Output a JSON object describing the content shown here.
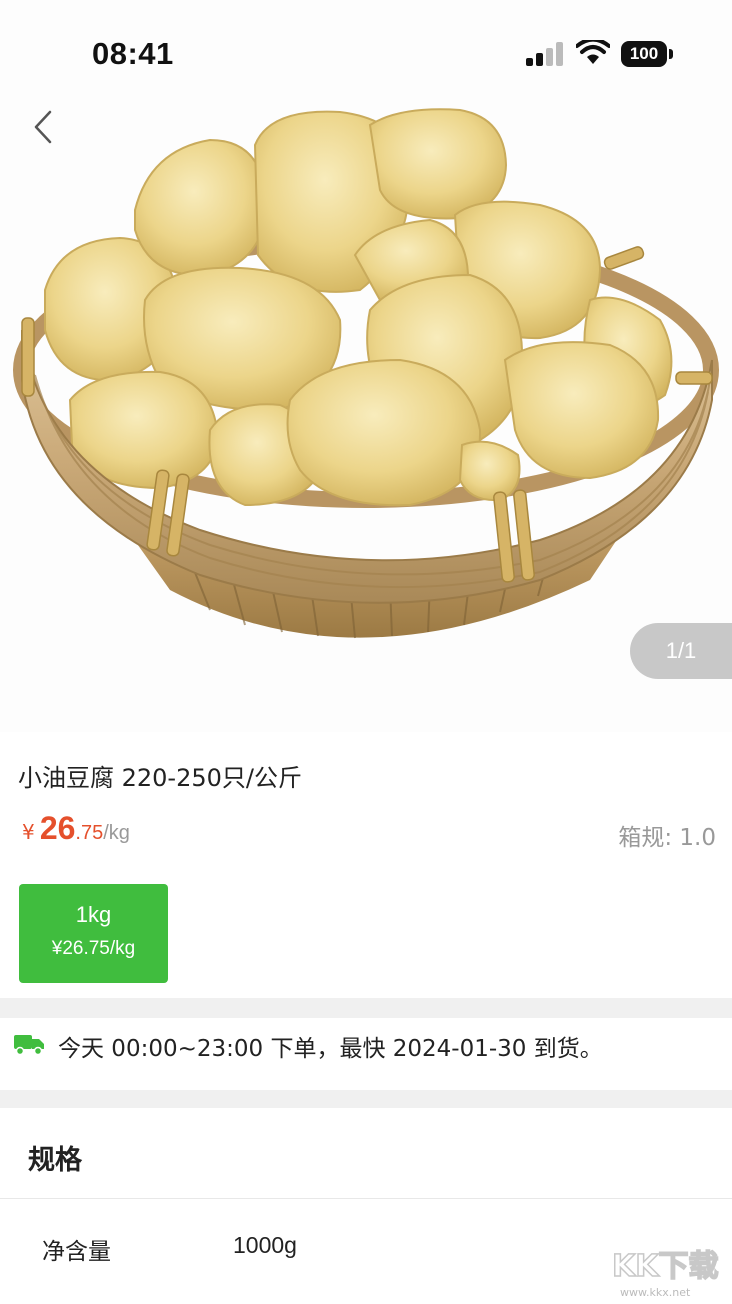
{
  "status_bar": {
    "time": "08:41",
    "battery": "100"
  },
  "hero": {
    "page_indicator": "1/1"
  },
  "product": {
    "title": "小油豆腐 220-250只/公斤",
    "price": {
      "currency": "¥",
      "integer": "26",
      "decimal": ".75",
      "unit": "/kg"
    },
    "box_spec": "箱规: 1.0",
    "sku": {
      "weight": "1kg",
      "price": "¥26.75/kg"
    }
  },
  "delivery": {
    "text": "今天 00:00~23:00 下单，最快 2024-01-30 到货。"
  },
  "specs": {
    "title": "规格",
    "rows": [
      {
        "key": "净含量",
        "value": "1000g"
      }
    ]
  },
  "watermark": {
    "brand": "KK下载",
    "url": "www.kkx.net"
  },
  "colors": {
    "price": "#e5502c",
    "accent_green": "#40bd3e"
  }
}
